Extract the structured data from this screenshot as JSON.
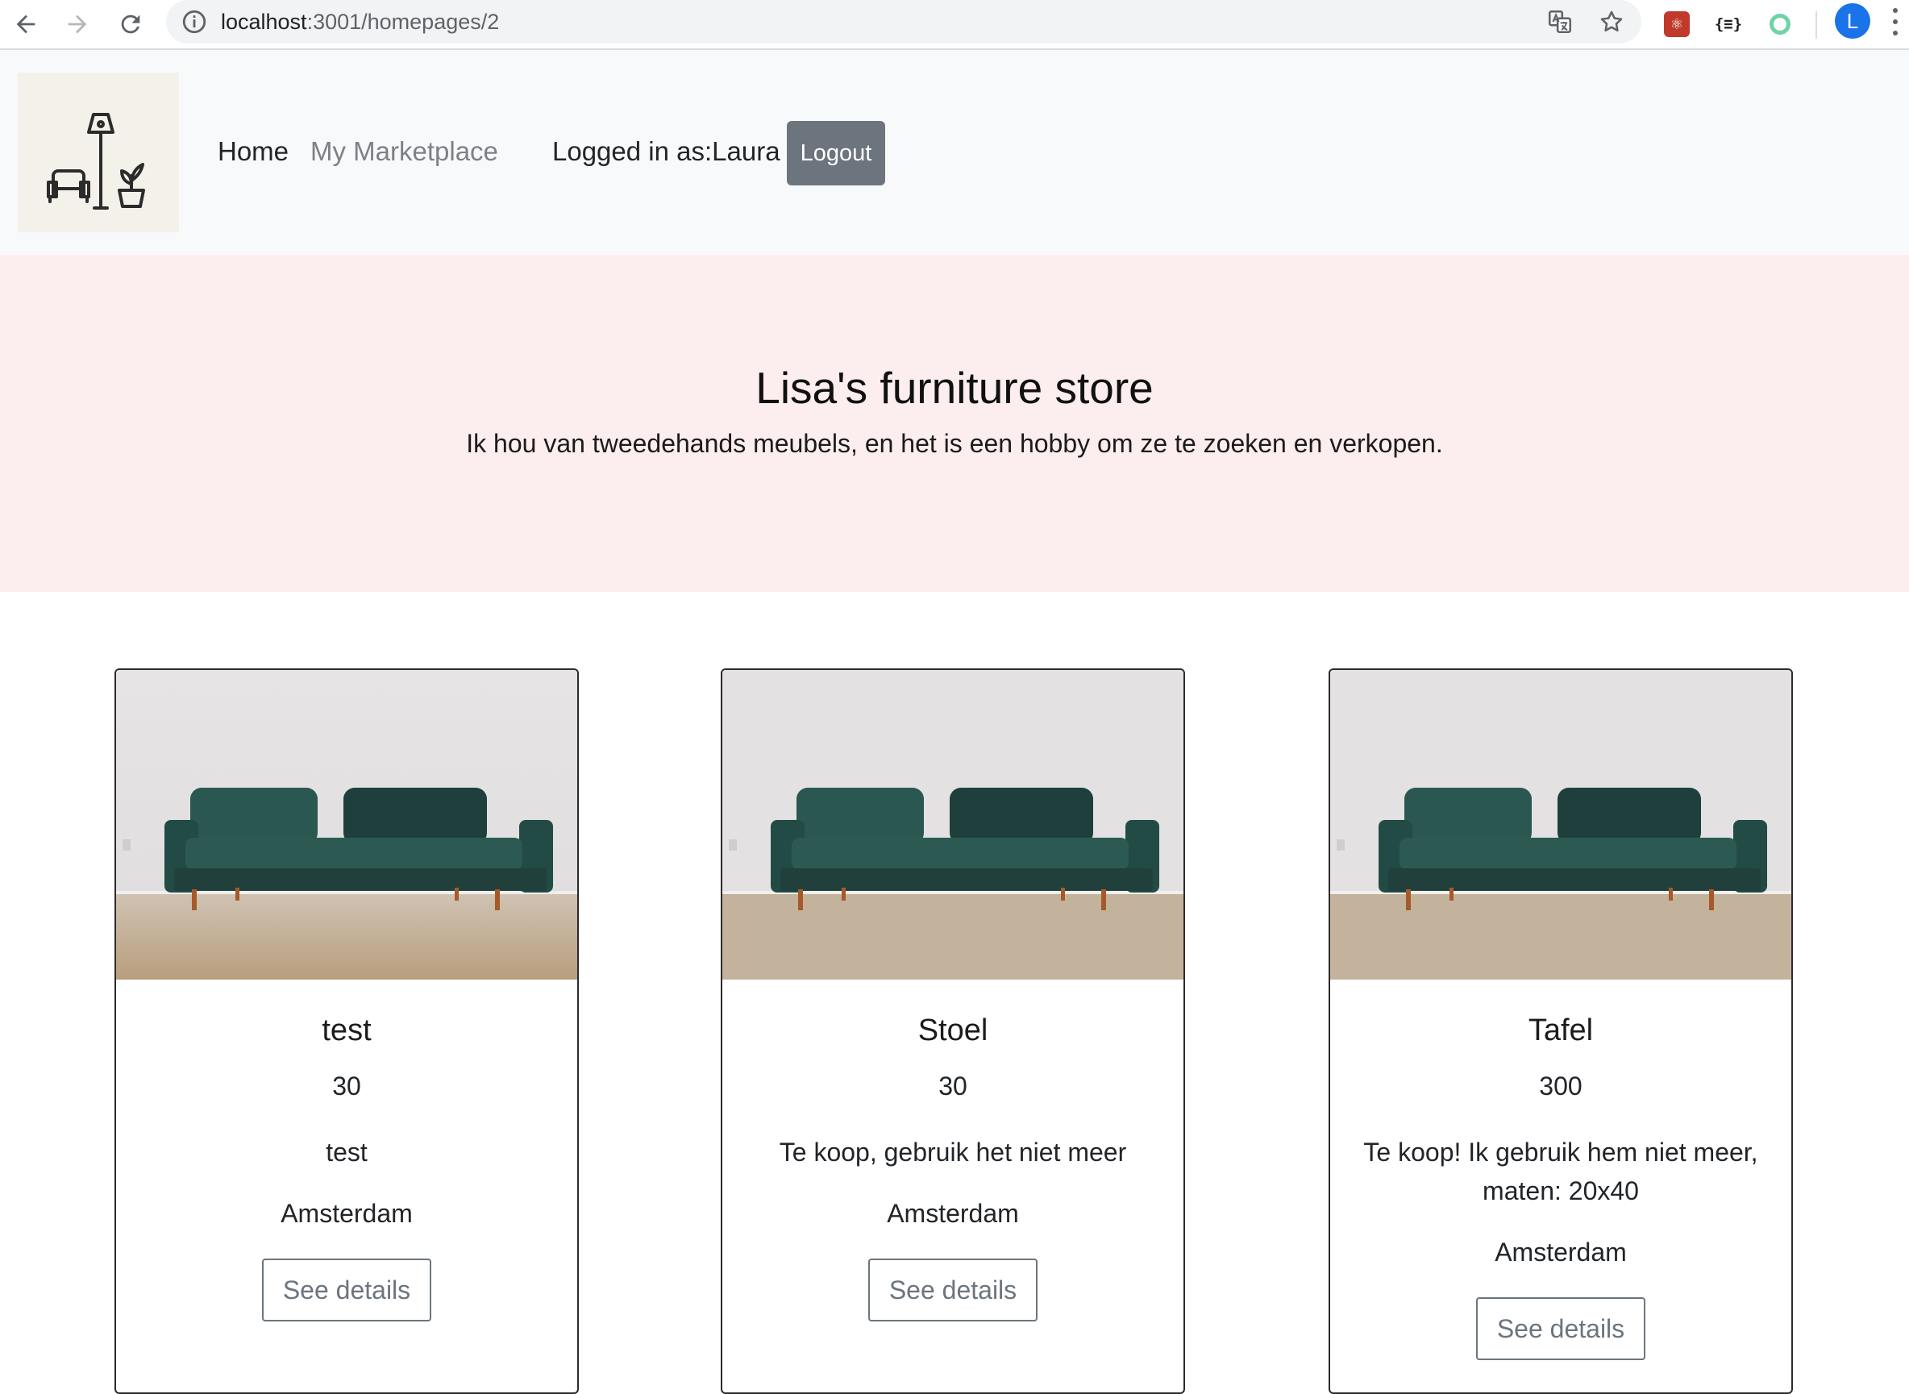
{
  "browser": {
    "url_host": "localhost",
    "url_path": ":3001/homepages/2",
    "profile_initial": "L",
    "extension_json_label": "{≡}"
  },
  "navbar": {
    "home_label": "Home",
    "marketplace_label": "My Marketplace",
    "logged_in_text": "Logged in as:Laura",
    "logout_label": "Logout"
  },
  "hero": {
    "title": "Lisa's furniture store",
    "subtitle": "Ik hou van tweedehands meubels, en het is een hobby om ze te zoeken en verkopen."
  },
  "products": [
    {
      "title": "test",
      "price": "30",
      "description": "test",
      "location": "Amsterdam",
      "button_label": "See details"
    },
    {
      "title": "Stoel",
      "price": "30",
      "description": "Te koop, gebruik het niet meer",
      "location": "Amsterdam",
      "button_label": "See details"
    },
    {
      "title": "Tafel",
      "price": "300",
      "description": "Te koop! Ik gebruik hem niet meer, maten: 20x40",
      "location": "Amsterdam",
      "button_label": "See details"
    }
  ],
  "colors": {
    "navbar_bg": "#f8f9fa",
    "hero_bg": "#fcedee",
    "logout_bg": "#6c757d",
    "sofa": "#1f4a44",
    "logo_bg": "#f4f1ea"
  },
  "icons": {
    "back": "arrow-left-icon",
    "forward": "arrow-right-icon",
    "reload": "reload-icon",
    "info": "info-icon",
    "translate": "translate-icon",
    "bookmark": "star-icon",
    "menu": "kebab-menu-icon"
  }
}
